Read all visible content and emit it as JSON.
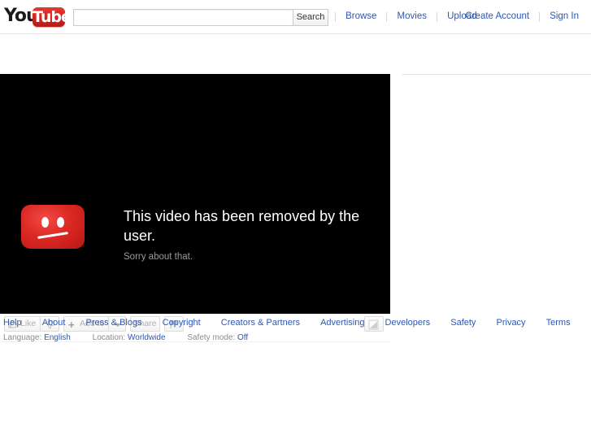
{
  "masthead": {
    "logo": {
      "you": "You",
      "tube": "Tube",
      "brand_red": "#cd2222"
    },
    "search": {
      "value": "",
      "placeholder": "",
      "button_label": "Search"
    },
    "nav_left": [
      {
        "label": "Browse",
        "name": "browse"
      },
      {
        "label": "Movies",
        "name": "movies"
      },
      {
        "label": "Upload",
        "name": "upload"
      }
    ],
    "nav_right": [
      {
        "label": "Create Account",
        "name": "create-account"
      },
      {
        "label": "Sign In",
        "name": "sign-in"
      }
    ]
  },
  "player": {
    "error_title": "This video has been removed by the user.",
    "error_subtitle": "Sorry about that.",
    "icon": "sad-face-icon",
    "background": "#000000"
  },
  "actionbar": {
    "like_label": "Like",
    "dislike_label": "",
    "addto_label": "Add to",
    "addto_plus": "+",
    "share_label": "Share",
    "flag_label": "",
    "stats_label": ""
  },
  "footer": {
    "links": [
      {
        "label": "Help",
        "name": "help"
      },
      {
        "label": "About",
        "name": "about"
      },
      {
        "label": "Press & Blogs",
        "name": "press-and-blogs"
      },
      {
        "label": "Copyright",
        "name": "copyright"
      },
      {
        "label": "Creators & Partners",
        "name": "creators-and-partners"
      },
      {
        "label": "Advertising",
        "name": "advertising"
      },
      {
        "label": "Developers",
        "name": "developers"
      },
      {
        "label": "Safety",
        "name": "safety"
      },
      {
        "label": "Privacy",
        "name": "privacy"
      },
      {
        "label": "Terms",
        "name": "terms"
      }
    ],
    "settings": [
      {
        "label": "Language:",
        "value": "English",
        "name": "language"
      },
      {
        "label": "Location:",
        "value": "Worldwide",
        "name": "location"
      },
      {
        "label": "Safety mode:",
        "value": "Off",
        "name": "safety-mode"
      }
    ]
  }
}
